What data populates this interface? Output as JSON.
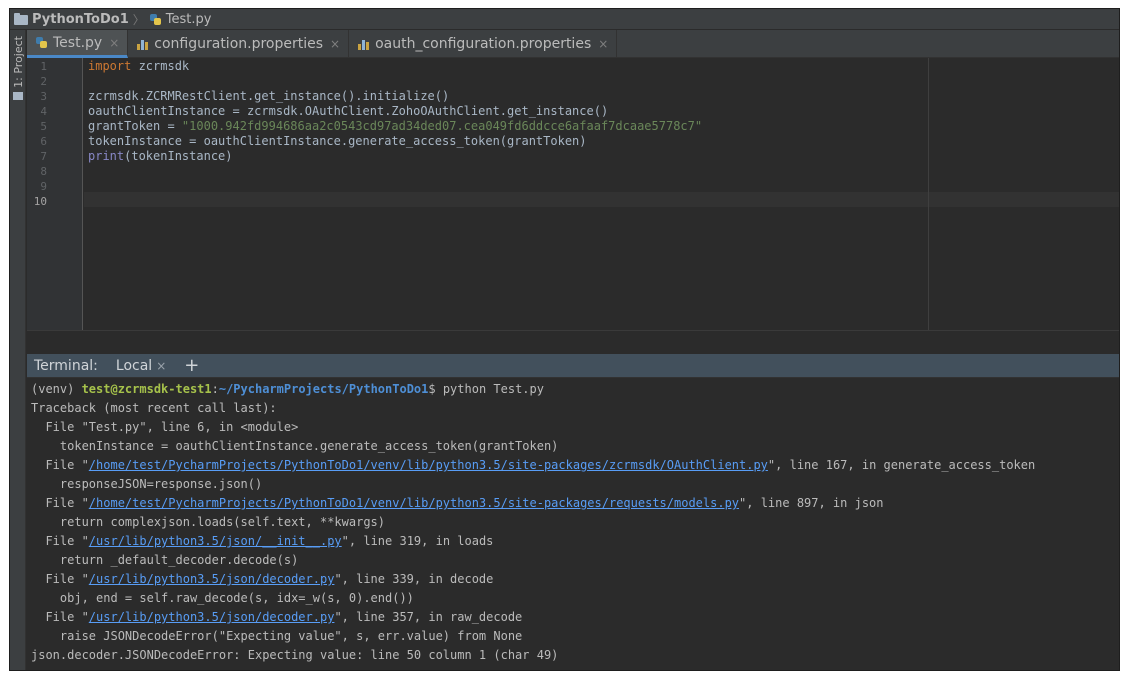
{
  "navbar": {
    "project": "PythonToDo1",
    "separator": "〉",
    "file": "Test.py"
  },
  "toolstrip": {
    "project_label": "1: Project"
  },
  "tabs": [
    {
      "label": "Test.py",
      "close": "×",
      "icon": "python-file-icon",
      "active": true
    },
    {
      "label": "configuration.properties",
      "close": "×",
      "icon": "properties-file-icon",
      "active": false
    },
    {
      "label": "oauth_configuration.properties",
      "close": "×",
      "icon": "properties-file-icon",
      "active": false
    }
  ],
  "editor": {
    "line_numbers": [
      "1",
      "2",
      "3",
      "4",
      "5",
      "6",
      "7",
      "8",
      "9",
      "10"
    ],
    "current_line": "10",
    "code": {
      "l1_kw": "import",
      "l1_rest": " zcrmsdk",
      "l3": "zcrmsdk.ZCRMRestClient.get_instance().initialize()",
      "l4": "oauthClientInstance = zcrmsdk.OAuthClient.ZohoOAuthClient.get_instance()",
      "l5_var": "grantToken = ",
      "l5_str": "\"1000.942fd994686aa2c0543cd97ad34ded07.cea049fd6ddcce6afaaf7dcaae5778c7\"",
      "l6": "tokenInstance = oauthClientInstance.generate_access_token(grantToken)",
      "l7_fn": "print",
      "l7_rest": "(tokenInstance)"
    }
  },
  "terminal": {
    "header_title": "Terminal:",
    "tab_label": "Local",
    "tab_close": "×",
    "add_label": "+",
    "prompt": {
      "venv": "(venv) ",
      "user": "test@zcrmsdk-test1",
      "colon": ":",
      "path": "~/PycharmProjects/PythonToDo1",
      "cmd": "$ python Test.py"
    },
    "lines": {
      "traceback": "Traceback (most recent call last):",
      "f1": "  File \"Test.py\", line 6, in <module>",
      "f1_code": "    tokenInstance = oauthClientInstance.generate_access_token(grantToken)",
      "f2_pre": "  File \"",
      "f2_link": "/home/test/PycharmProjects/PythonToDo1/venv/lib/python3.5/site-packages/zcrmsdk/OAuthClient.py",
      "f2_post": "\", line 167, in generate_access_token",
      "f2_code": "    responseJSON=response.json()",
      "f3_pre": "  File \"",
      "f3_link": "/home/test/PycharmProjects/PythonToDo1/venv/lib/python3.5/site-packages/requests/models.py",
      "f3_post": "\", line 897, in json",
      "f3_code": "    return complexjson.loads(self.text, **kwargs)",
      "f4_pre": "  File \"",
      "f4_link": "/usr/lib/python3.5/json/__init__.py",
      "f4_post": "\", line 319, in loads",
      "f4_code": "    return _default_decoder.decode(s)",
      "f5_pre": "  File \"",
      "f5_link": "/usr/lib/python3.5/json/decoder.py",
      "f5_post": "\", line 339, in decode",
      "f5_code": "    obj, end = self.raw_decode(s, idx=_w(s, 0).end())",
      "f6_pre": "  File \"",
      "f6_link": "/usr/lib/python3.5/json/decoder.py",
      "f6_post": "\", line 357, in raw_decode",
      "f6_code": "    raise JSONDecodeError(\"Expecting value\", s, err.value) from None",
      "error": "json.decoder.JSONDecodeError: Expecting value: line 50 column 1 (char 49)"
    }
  },
  "colors": {
    "background": "#2b2b2b",
    "keyword": "#cc7832",
    "string": "#6a8759",
    "link": "#589df6",
    "prompt_user": "#a6c24b",
    "prompt_path": "#4e8fd6",
    "active_tab_underline": "#4a88c7"
  }
}
